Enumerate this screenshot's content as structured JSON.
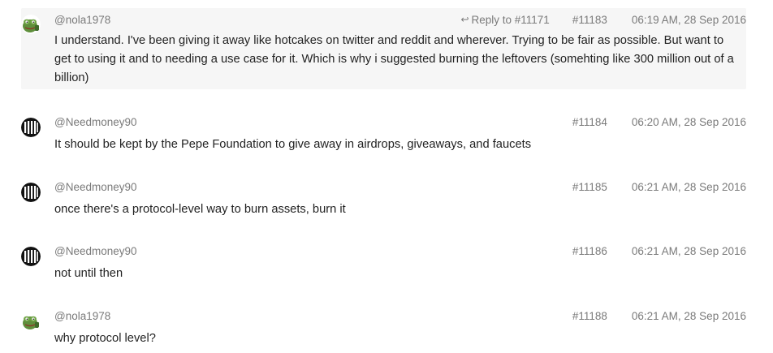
{
  "messages": [
    {
      "user": "@nola1978",
      "avatar": "pepe-frog-avatar",
      "reply_label": "Reply to #11171",
      "id": "#11183",
      "time": "06:19 AM, 28 Sep 2016",
      "text": "I understand. I've been giving it away like hotcakes on twitter and reddit and wherever. Trying to be fair as possible. But want to get to using it and to needing a use case for it. Which is why i suggested burning the leftovers (somehting like 300 million out of a billion)",
      "highlighted": true
    },
    {
      "user": "@Needmoney90",
      "avatar": "striped-logo-avatar",
      "id": "#11184",
      "time": "06:20 AM, 28 Sep 2016",
      "text": "It should be kept by the Pepe Foundation to give away in airdrops, giveaways, and faucets"
    },
    {
      "user": "@Needmoney90",
      "avatar": "striped-logo-avatar",
      "id": "#11185",
      "time": "06:21 AM, 28 Sep 2016",
      "text": "once there's a protocol-level way to burn assets, burn it"
    },
    {
      "user": "@Needmoney90",
      "avatar": "striped-logo-avatar",
      "id": "#11186",
      "time": "06:21 AM, 28 Sep 2016",
      "text": "not until then"
    },
    {
      "user": "@nola1978",
      "avatar": "pepe-frog-avatar",
      "id": "#11188",
      "time": "06:21 AM, 28 Sep 2016",
      "text": "why protocol level?"
    }
  ],
  "icons": {
    "reply": "reply-arrow-icon"
  },
  "colors": {
    "highlight_bg": "#f6f6f6",
    "meta_text": "#7a7a7a",
    "body_text": "#222222"
  }
}
